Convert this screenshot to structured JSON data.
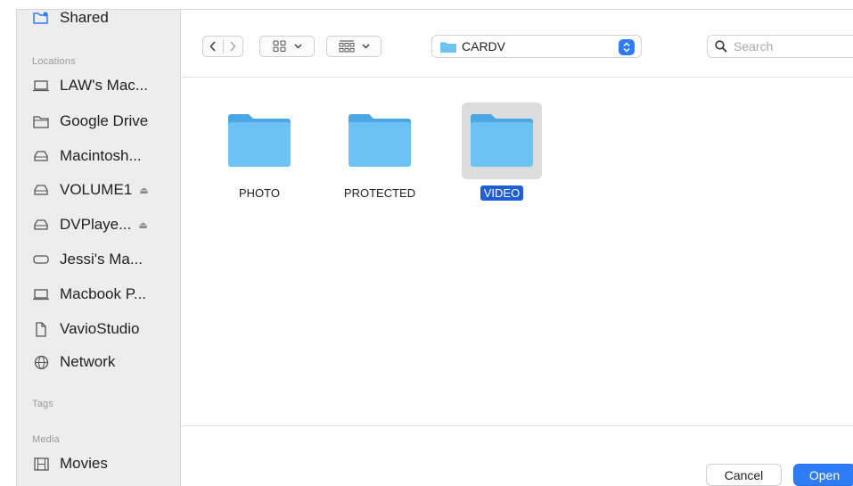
{
  "sidebar": {
    "shared_label": "Shared",
    "locations_heading": "Locations",
    "locations": [
      {
        "label": "LAW's Mac...",
        "icon": "laptop-icon"
      },
      {
        "label": "Google Drive",
        "icon": "folder-outline-icon"
      },
      {
        "label": "Macintosh...",
        "icon": "disk-icon"
      },
      {
        "label": "VOLUME1",
        "icon": "disk-icon",
        "eject": "⏏"
      },
      {
        "label": "DVPlaye...",
        "icon": "disk-icon",
        "eject": "⏏"
      },
      {
        "label": "Jessi's Ma...",
        "icon": "drive-icon"
      },
      {
        "label": "Macbook P...",
        "icon": "laptop-icon"
      },
      {
        "label": "VavioStudio",
        "icon": "document-icon"
      },
      {
        "label": "Network",
        "icon": "globe-icon"
      }
    ],
    "tags_heading": "Tags",
    "media_heading": "Media",
    "media": [
      {
        "label": "Movies",
        "icon": "film-icon"
      }
    ]
  },
  "toolbar": {
    "current_folder": "CARDV",
    "search_placeholder": "Search"
  },
  "files": [
    {
      "name": "PHOTO",
      "selected": false
    },
    {
      "name": "PROTECTED",
      "selected": false
    },
    {
      "name": "VIDEO",
      "selected": true
    }
  ],
  "footer": {
    "cancel_label": "Cancel",
    "open_label": "Open"
  },
  "colors": {
    "accent": "#2f7df6",
    "selection": "#1f5fd3",
    "folder": "#5bb8f0"
  }
}
